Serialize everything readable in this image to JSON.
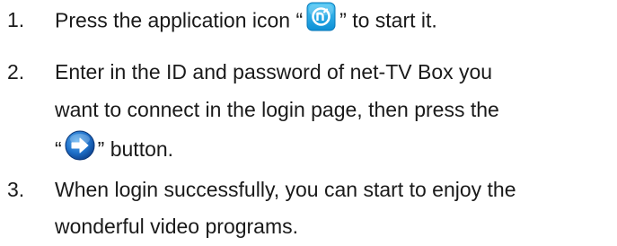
{
  "steps": [
    {
      "number": "1.",
      "before_icon": "Press the application icon “",
      "icon": "app-logo-icon",
      "after_icon": "” to start it."
    },
    {
      "number": "2.",
      "line1": "Enter in the ID and password of net-TV Box you",
      "line2": "want to connect in the login page, then press the",
      "line3_before_icon": "“",
      "icon": "arrow-right-icon",
      "line3_after_icon": "” button."
    },
    {
      "number": "3.",
      "line1": "When login successfully, you can start to enjoy the",
      "line2": "wonderful video programs."
    }
  ],
  "colors": {
    "text": "#1a1a1a",
    "app_icon_bg": "#1aa6e8",
    "arrow_icon_bg": "#1e6fc8"
  }
}
